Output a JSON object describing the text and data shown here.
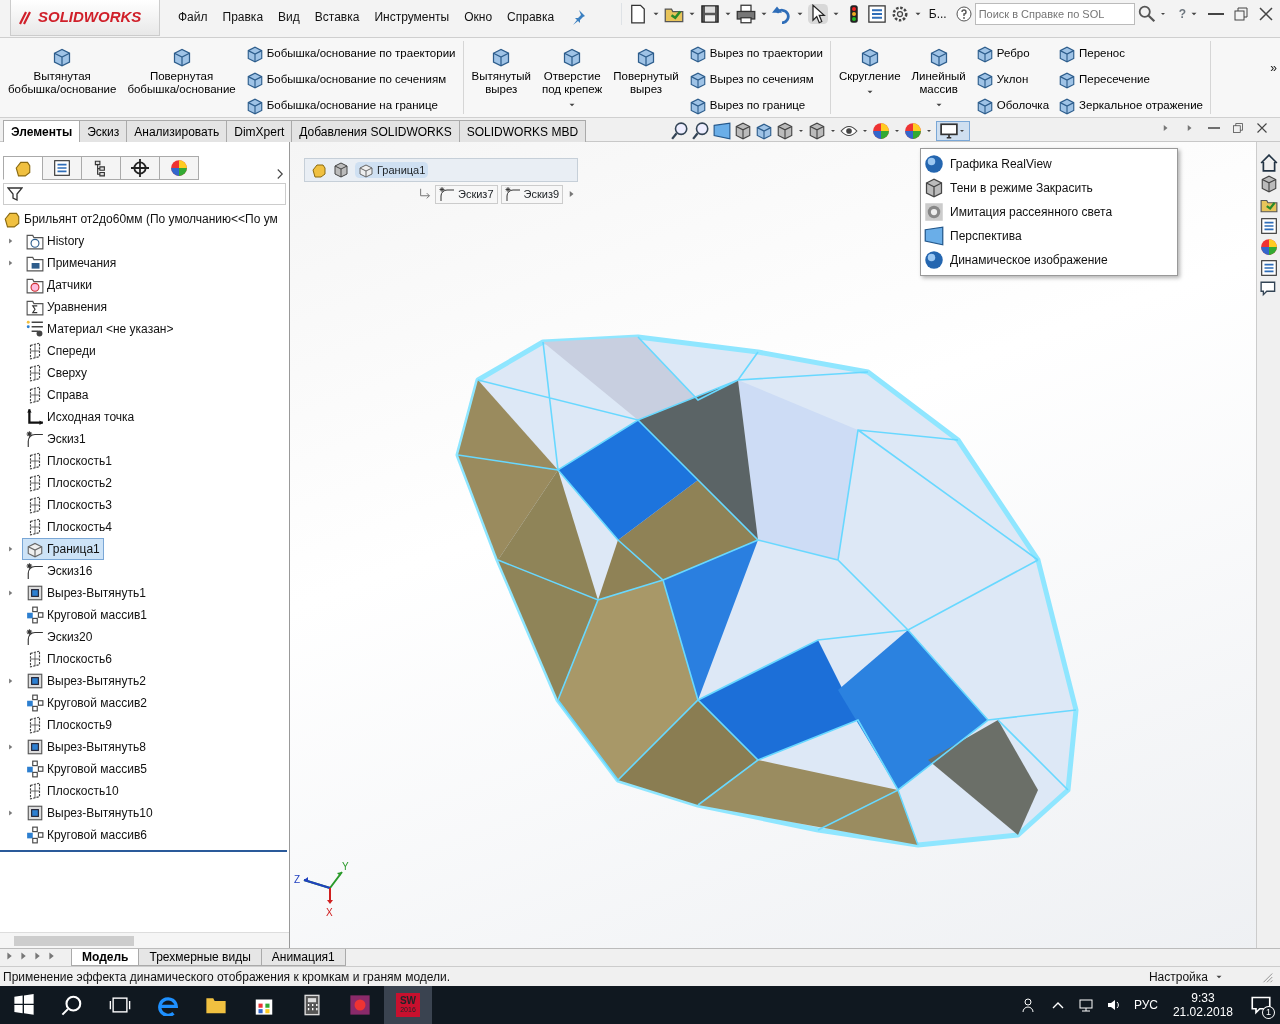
{
  "app": {
    "logo": "SOLIDWORKS"
  },
  "menu": [
    "Файл",
    "Правка",
    "Вид",
    "Вставка",
    "Инструменты",
    "Окно",
    "Справка"
  ],
  "quick_toolbar": {
    "truncated_label": "Б...",
    "search": {
      "placeholder": "Поиск в Справке по SOL"
    },
    "help": "?"
  },
  "ribbon": {
    "groups": [
      {
        "items": [
          {
            "kind": "large",
            "label": "Вытянутая\nбобышка/основание",
            "dropdown": false
          },
          {
            "kind": "large",
            "label": "Повернутая\nбобышка/основание",
            "dropdown": false
          },
          {
            "kind": "stack",
            "labels": [
              "Бобышка/основание по траектории",
              "Бобышка/основание по сечениям",
              "Бобышка/основание на границе"
            ]
          }
        ]
      },
      {
        "items": [
          {
            "kind": "large",
            "label": "Вытянутый\nвырез",
            "dropdown": false
          },
          {
            "kind": "large",
            "label": "Отверстие\nпод крепеж",
            "dropdown": true
          },
          {
            "kind": "large",
            "label": "Повернутый\nвырез",
            "dropdown": false
          },
          {
            "kind": "stack",
            "labels": [
              "Вырез по траектории",
              "Вырез по сечениям",
              "Вырез по границе"
            ]
          }
        ]
      },
      {
        "items": [
          {
            "kind": "large",
            "label": "Скругление",
            "dropdown": true
          },
          {
            "kind": "large",
            "label": "Линейный\nмассив",
            "dropdown": true
          },
          {
            "kind": "stack",
            "labels": [
              "Ребро",
              "Уклон",
              "Оболочка"
            ]
          },
          {
            "kind": "stack",
            "labels": [
              "Перенос",
              "Пересечение",
              "Зеркальное отражение"
            ]
          }
        ]
      }
    ],
    "overflow": "»"
  },
  "command_tabs": [
    {
      "label": "Элементы",
      "selected": true
    },
    {
      "label": "Эскиз",
      "selected": false
    },
    {
      "label": "Анализировать",
      "selected": false
    },
    {
      "label": "DimXpert",
      "selected": false
    },
    {
      "label": "Добавления SOLIDWORKS",
      "selected": false
    },
    {
      "label": "SOLIDWORKS MBD",
      "selected": false
    }
  ],
  "panel_tabs": [
    {
      "selected": true
    },
    {
      "selected": false
    },
    {
      "selected": false
    },
    {
      "selected": false
    },
    {
      "selected": false
    }
  ],
  "tree": {
    "root": "Брильянт от2до60мм  (По умолчанию<<По ум",
    "items": [
      {
        "kind": "history",
        "label": "History",
        "expandable": true,
        "selected": false
      },
      {
        "kind": "annotations",
        "label": "Примечания",
        "expandable": true,
        "selected": false
      },
      {
        "kind": "sensors",
        "label": "Датчики",
        "expandable": false,
        "selected": false
      },
      {
        "kind": "equations",
        "label": "Уравнения",
        "expandable": false,
        "selected": false
      },
      {
        "kind": "material",
        "label": "Материал <не указан>",
        "expandable": false,
        "selected": false
      },
      {
        "kind": "plane",
        "label": "Спереди",
        "expandable": false,
        "selected": false
      },
      {
        "kind": "plane",
        "label": "Сверху",
        "expandable": false,
        "selected": false
      },
      {
        "kind": "plane",
        "label": "Справа",
        "expandable": false,
        "selected": false
      },
      {
        "kind": "origin",
        "label": "Исходная точка",
        "expandable": false,
        "selected": false
      },
      {
        "kind": "sketch",
        "label": "Эскиз1",
        "expandable": false,
        "selected": false
      },
      {
        "kind": "plane",
        "label": "Плоскость1",
        "expandable": false,
        "selected": false
      },
      {
        "kind": "plane",
        "label": "Плоскость2",
        "expandable": false,
        "selected": false
      },
      {
        "kind": "plane",
        "label": "Плоскость3",
        "expandable": false,
        "selected": false
      },
      {
        "kind": "plane",
        "label": "Плоскость4",
        "expandable": false,
        "selected": false
      },
      {
        "kind": "boundary",
        "label": "Граница1",
        "expandable": true,
        "selected": true
      },
      {
        "kind": "sketch",
        "label": "Эскиз16",
        "expandable": false,
        "selected": false
      },
      {
        "kind": "cut",
        "label": "Вырез-Вытянуть1",
        "expandable": true,
        "selected": false
      },
      {
        "kind": "pattern",
        "label": "Круговой массив1",
        "expandable": false,
        "selected": false
      },
      {
        "kind": "sketch",
        "label": "Эскиз20",
        "expandable": false,
        "selected": false
      },
      {
        "kind": "plane",
        "label": "Плоскость6",
        "expandable": false,
        "selected": false
      },
      {
        "kind": "cut",
        "label": "Вырез-Вытянуть2",
        "expandable": true,
        "selected": false
      },
      {
        "kind": "pattern",
        "label": "Круговой массив2",
        "expandable": false,
        "selected": false
      },
      {
        "kind": "plane",
        "label": "Плоскость9",
        "expandable": false,
        "selected": false
      },
      {
        "kind": "cut",
        "label": "Вырез-Вытянуть8",
        "expandable": true,
        "selected": false
      },
      {
        "kind": "pattern",
        "label": "Круговой массив5",
        "expandable": false,
        "selected": false
      },
      {
        "kind": "plane",
        "label": "Плоскость10",
        "expandable": false,
        "selected": false
      },
      {
        "kind": "cut",
        "label": "Вырез-Вытянуть10",
        "expandable": true,
        "selected": false
      },
      {
        "kind": "pattern",
        "label": "Круговой массив6",
        "expandable": false,
        "selected": false
      }
    ]
  },
  "breadcrumb": {
    "current": "Граница1",
    "children": [
      "Эскиз7",
      "Эскиз9"
    ]
  },
  "display_menu": [
    {
      "label": "Графика RealView"
    },
    {
      "label": "Тени в режиме Закрасить"
    },
    {
      "label": "Имитация рассеянного света"
    },
    {
      "label": "Перспектива"
    },
    {
      "label": "Динамическое изображение"
    }
  ],
  "triad": {
    "x": "X",
    "y": "Y",
    "z": "Z"
  },
  "bottom_tabs": [
    {
      "label": "Модель",
      "selected": true
    },
    {
      "label": "Трехмерные виды",
      "selected": false
    },
    {
      "label": "Анимация1",
      "selected": false
    }
  ],
  "status_bar": {
    "message": "Применение эффекта динамического отображения к кромкам и граням модели.",
    "customize": "Настройка"
  },
  "taskbar": {
    "app_label": "SW",
    "app_year": "2016",
    "language": "РУС",
    "time": "9:33",
    "date": "21.02.2018",
    "notifications": "1"
  }
}
